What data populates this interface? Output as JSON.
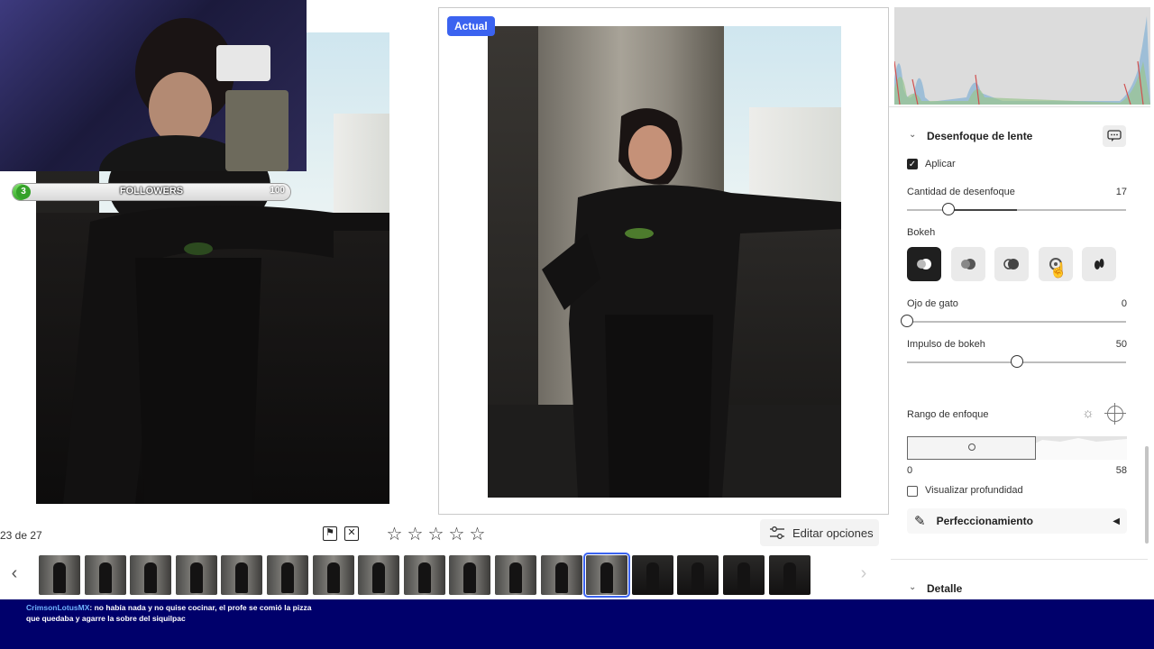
{
  "before": {
    "counter": "23 de 27"
  },
  "after": {
    "badge": "Actual"
  },
  "overlay": {
    "followers_count": "3",
    "followers_label": "FOLLOWERS",
    "followers_goal": "100",
    "followers_progress": 0.03
  },
  "toolbar": {
    "flag_pick_icon": "flag-icon",
    "flag_reject_icon": "reject-flag-icon",
    "rating_stars": 5,
    "rating_value": 0,
    "edit_options_label": "Editar opciones"
  },
  "filmstrip": {
    "thumb_count": 17,
    "selected_index": 12
  },
  "chat": {
    "user": "CrimsonLotusMX",
    "message": ": no había nada y no quise cocinar, el profe se comió la pizza que quedaba y agarre la sobre del siquilpac"
  },
  "panel": {
    "section_title": "Desenfoque de lente",
    "apply_label": "Aplicar",
    "apply_checked": true,
    "blur_amount_label": "Cantidad de desenfoque",
    "blur_amount_value": "17",
    "blur_amount_fraction": 0.19,
    "bokeh_label": "Bokeh",
    "bokeh_options": [
      "bokeh-circle-icon",
      "bokeh-bubble-icon",
      "bokeh-ring-icon",
      "bokeh-blade-icon",
      "bokeh-cat-eye-icon"
    ],
    "bokeh_selected": 0,
    "cat_eye_label": "Ojo de gato",
    "cat_eye_value": "0",
    "cat_eye_fraction": 0,
    "boost_label": "Impulso de bokeh",
    "boost_value": "50",
    "boost_fraction": 0.5,
    "focus_range_label": "Rango de enfoque",
    "focus_range_min": "0",
    "focus_range_max": "58",
    "visualize_depth_label": "Visualizar profundidad",
    "visualize_depth_checked": false,
    "refine_label": "Perfeccionamiento",
    "detail_label": "Detalle"
  },
  "colors": {
    "accent": "#3b63f0",
    "chat_bg": "#00006b",
    "followers_fill": "#36a82a"
  }
}
